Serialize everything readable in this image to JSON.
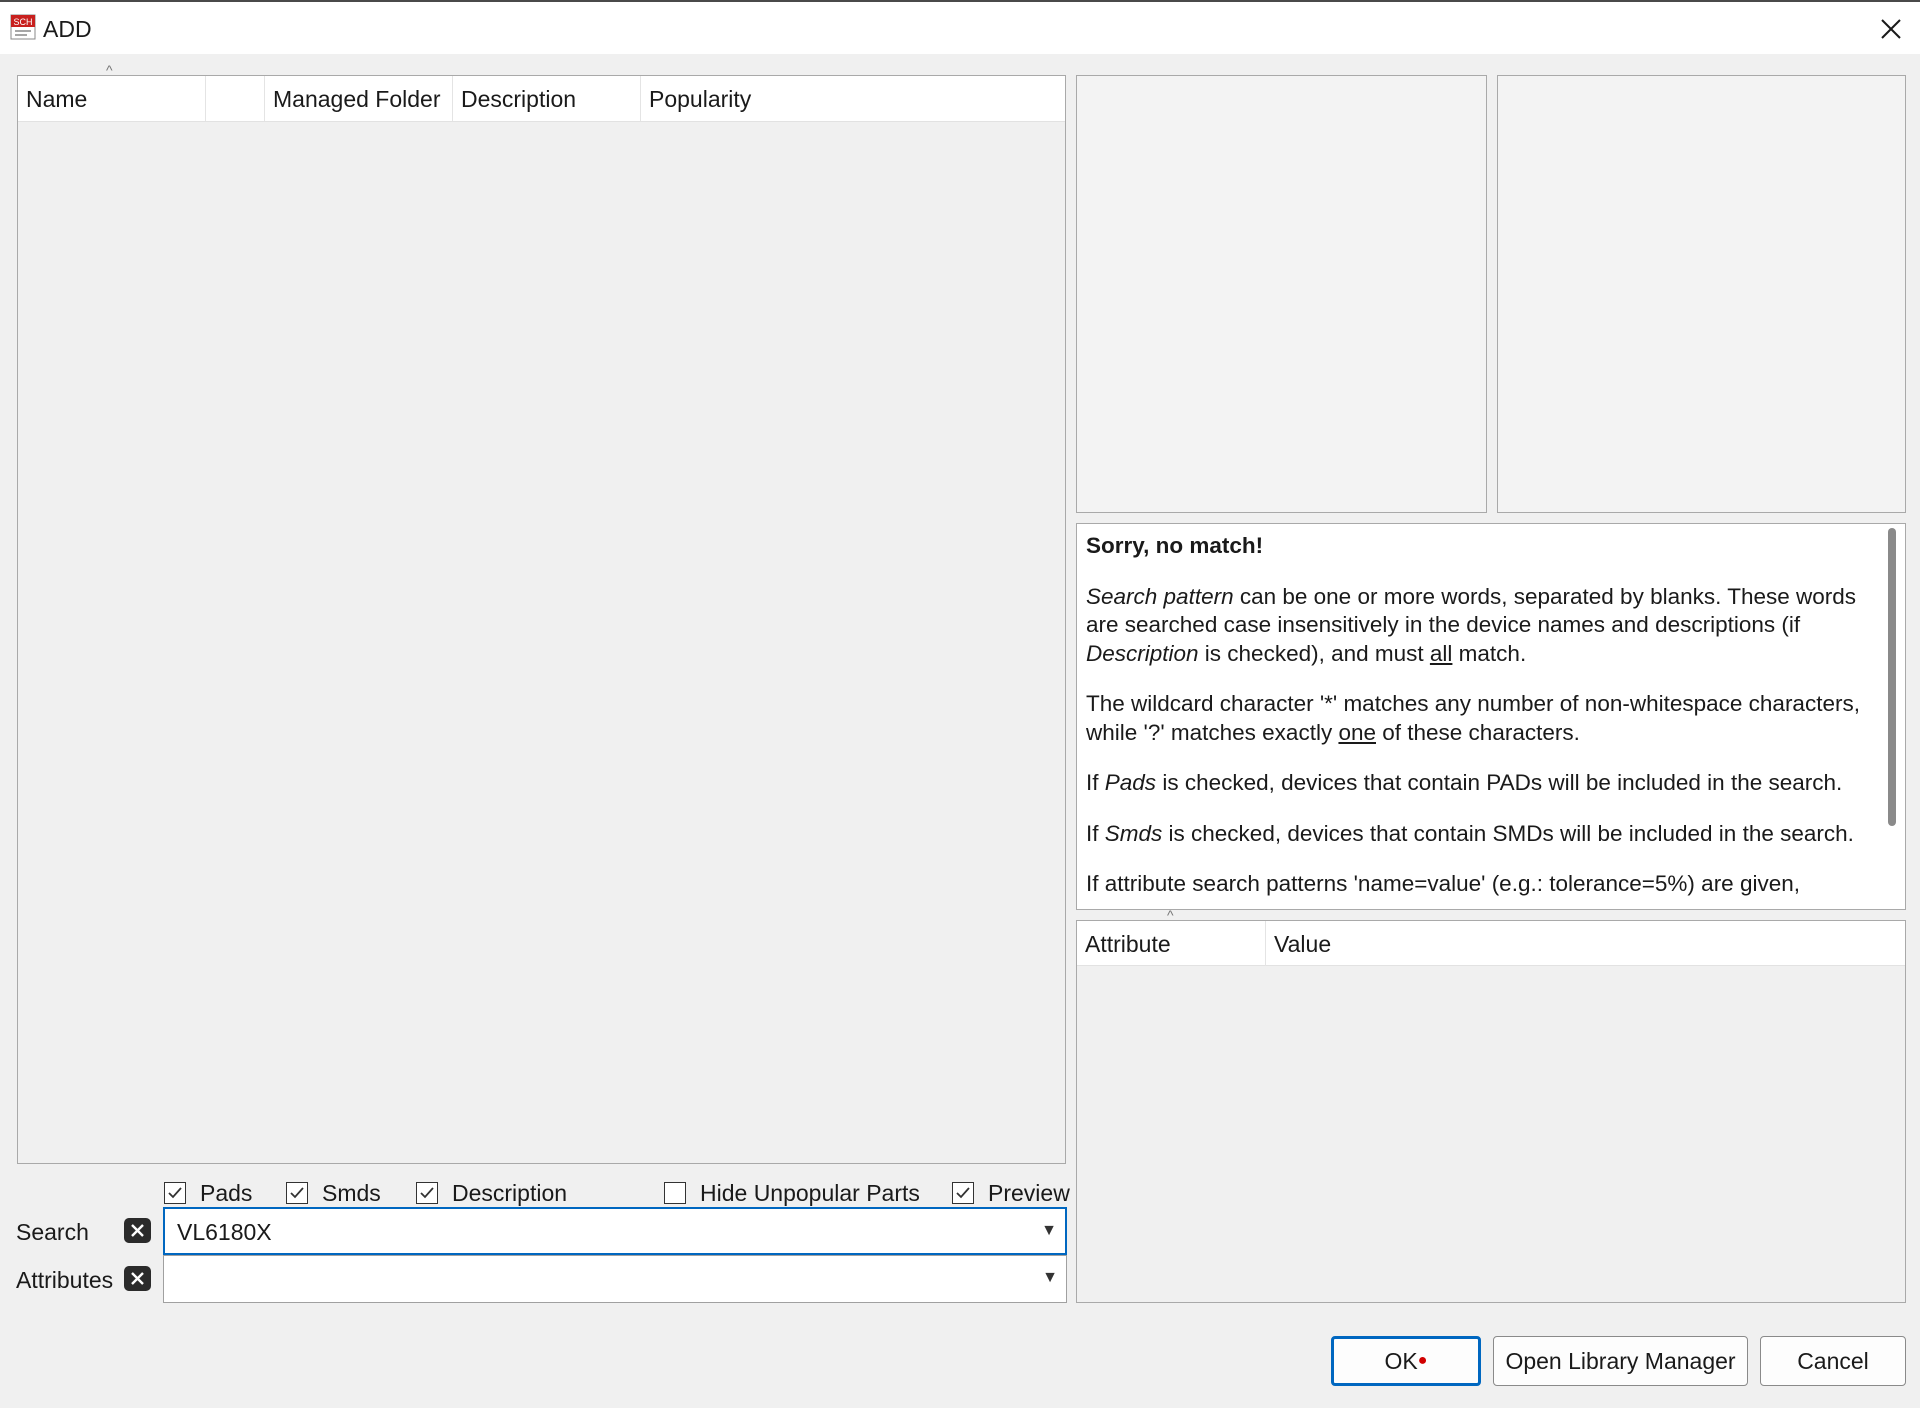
{
  "window": {
    "title": "ADD",
    "icon": "sch-icon",
    "icon_text": "SCH",
    "close_icon": "close-icon"
  },
  "device_list": {
    "columns": [
      "Name",
      "",
      "Managed Folder",
      "Description",
      "Popularity"
    ],
    "rows": []
  },
  "info": {
    "heading": "Sorry, no match!",
    "para1_em": "Search pattern",
    "para1_a": " can be one or more words, separated by blanks. These words are searched case insensitively in the device names and descriptions (if ",
    "para1_em2": "Description",
    "para1_b": " is checked), and must ",
    "para1_u": "all",
    "para1_c": " match.",
    "para2_a": "The wildcard character '*' matches any number of non-whitespace characters, while '?' matches exactly ",
    "para2_u": "one",
    "para2_b": " of these characters.",
    "para3_a": "If ",
    "para3_em": "Pads",
    "para3_b": " is checked, devices that contain PADs will be included in the search.",
    "para4_a": "If ",
    "para4_em": "Smds",
    "para4_b": " is checked, devices that contain SMDs will be included in the search.",
    "para5": "If attribute search patterns 'name=value' (e.g.: tolerance=5%) are given,"
  },
  "attributes_table": {
    "columns": [
      "Attribute",
      "Value"
    ]
  },
  "options": {
    "pads": {
      "label": "Pads",
      "checked": true
    },
    "smds": {
      "label": "Smds",
      "checked": true
    },
    "description": {
      "label": "Description",
      "checked": true
    },
    "hide_unpopular": {
      "label": "Hide Unpopular Parts",
      "checked": false
    },
    "preview": {
      "label": "Preview",
      "checked": true
    }
  },
  "search": {
    "label": "Search",
    "value": "VL6180X"
  },
  "attributes_filter": {
    "label": "Attributes",
    "value": ""
  },
  "buttons": {
    "ok": "OK",
    "open_library_manager": "Open Library Manager",
    "cancel": "Cancel"
  },
  "colors": {
    "accent": "#0067c0",
    "background": "#f0f0f0",
    "icon_red": "#c8201e"
  }
}
